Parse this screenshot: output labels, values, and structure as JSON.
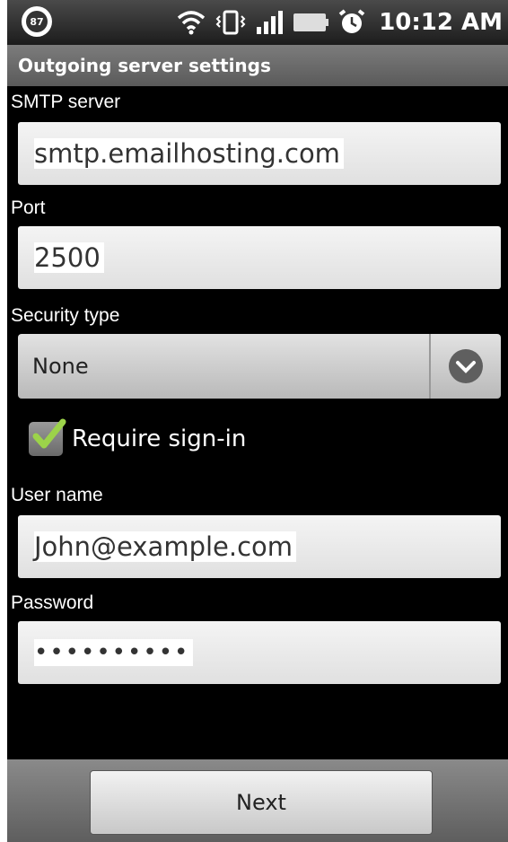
{
  "status_bar": {
    "battery_badge": "87",
    "time": "10:12 AM",
    "icons": [
      "wifi-icon",
      "vibrate-icon",
      "signal-icon",
      "battery-icon",
      "alarm-icon"
    ]
  },
  "title": "Outgoing server settings",
  "fields": {
    "smtp": {
      "label": "SMTP server",
      "value": "smtp.emailhosting.com"
    },
    "port": {
      "label": "Port",
      "value": "2500"
    },
    "security": {
      "label": "Security type",
      "value": "None"
    },
    "require_signin": {
      "label": "Require sign-in",
      "checked": true
    },
    "username": {
      "label": "User name",
      "value": "John@example.com"
    },
    "password": {
      "label": "Password",
      "value": "••••••••••"
    }
  },
  "buttons": {
    "next": "Next"
  }
}
